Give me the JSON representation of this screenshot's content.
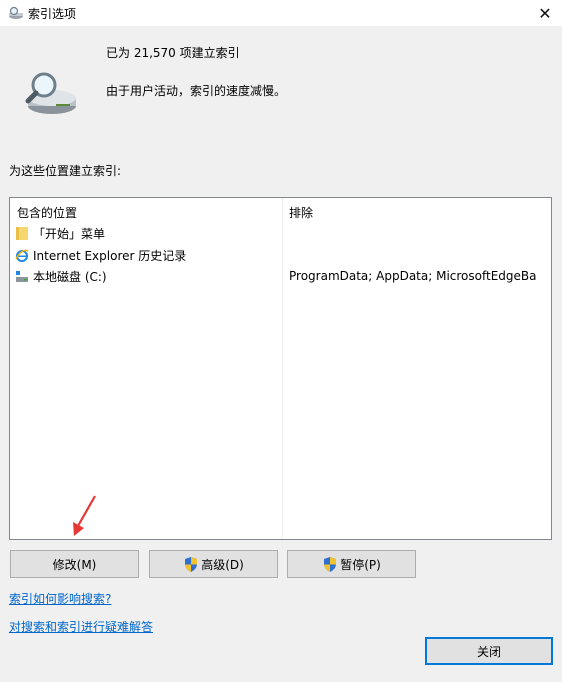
{
  "window": {
    "title": "索引选项",
    "close_glyph": "✕"
  },
  "status": {
    "indexed_count": "已为 21,570 项建立索引",
    "activity": "由于用户活动，索引的速度减慢。"
  },
  "locations_label": "为这些位置建立索引:",
  "table": {
    "columns": [
      "包含的位置",
      "排除"
    ],
    "rows": [
      {
        "name": "「开始」菜单",
        "icon": "folder-icon",
        "exclude": ""
      },
      {
        "name": "Internet Explorer 历史记录",
        "icon": "ie-icon",
        "exclude": ""
      },
      {
        "name": "本地磁盘 (C:)",
        "icon": "drive-icon",
        "exclude": "ProgramData; AppData; MicrosoftEdgeBa"
      }
    ]
  },
  "buttons": {
    "modify": "修改(M)",
    "advanced": "高级(D)",
    "pause": "暂停(P)",
    "close": "关闭"
  },
  "links": {
    "how_affects": "索引如何影响搜索?",
    "troubleshoot": "对搜索和索引进行疑难解答"
  },
  "colors": {
    "accent": "#0078d7",
    "link": "#0066cc",
    "arrow": "#e53935"
  }
}
